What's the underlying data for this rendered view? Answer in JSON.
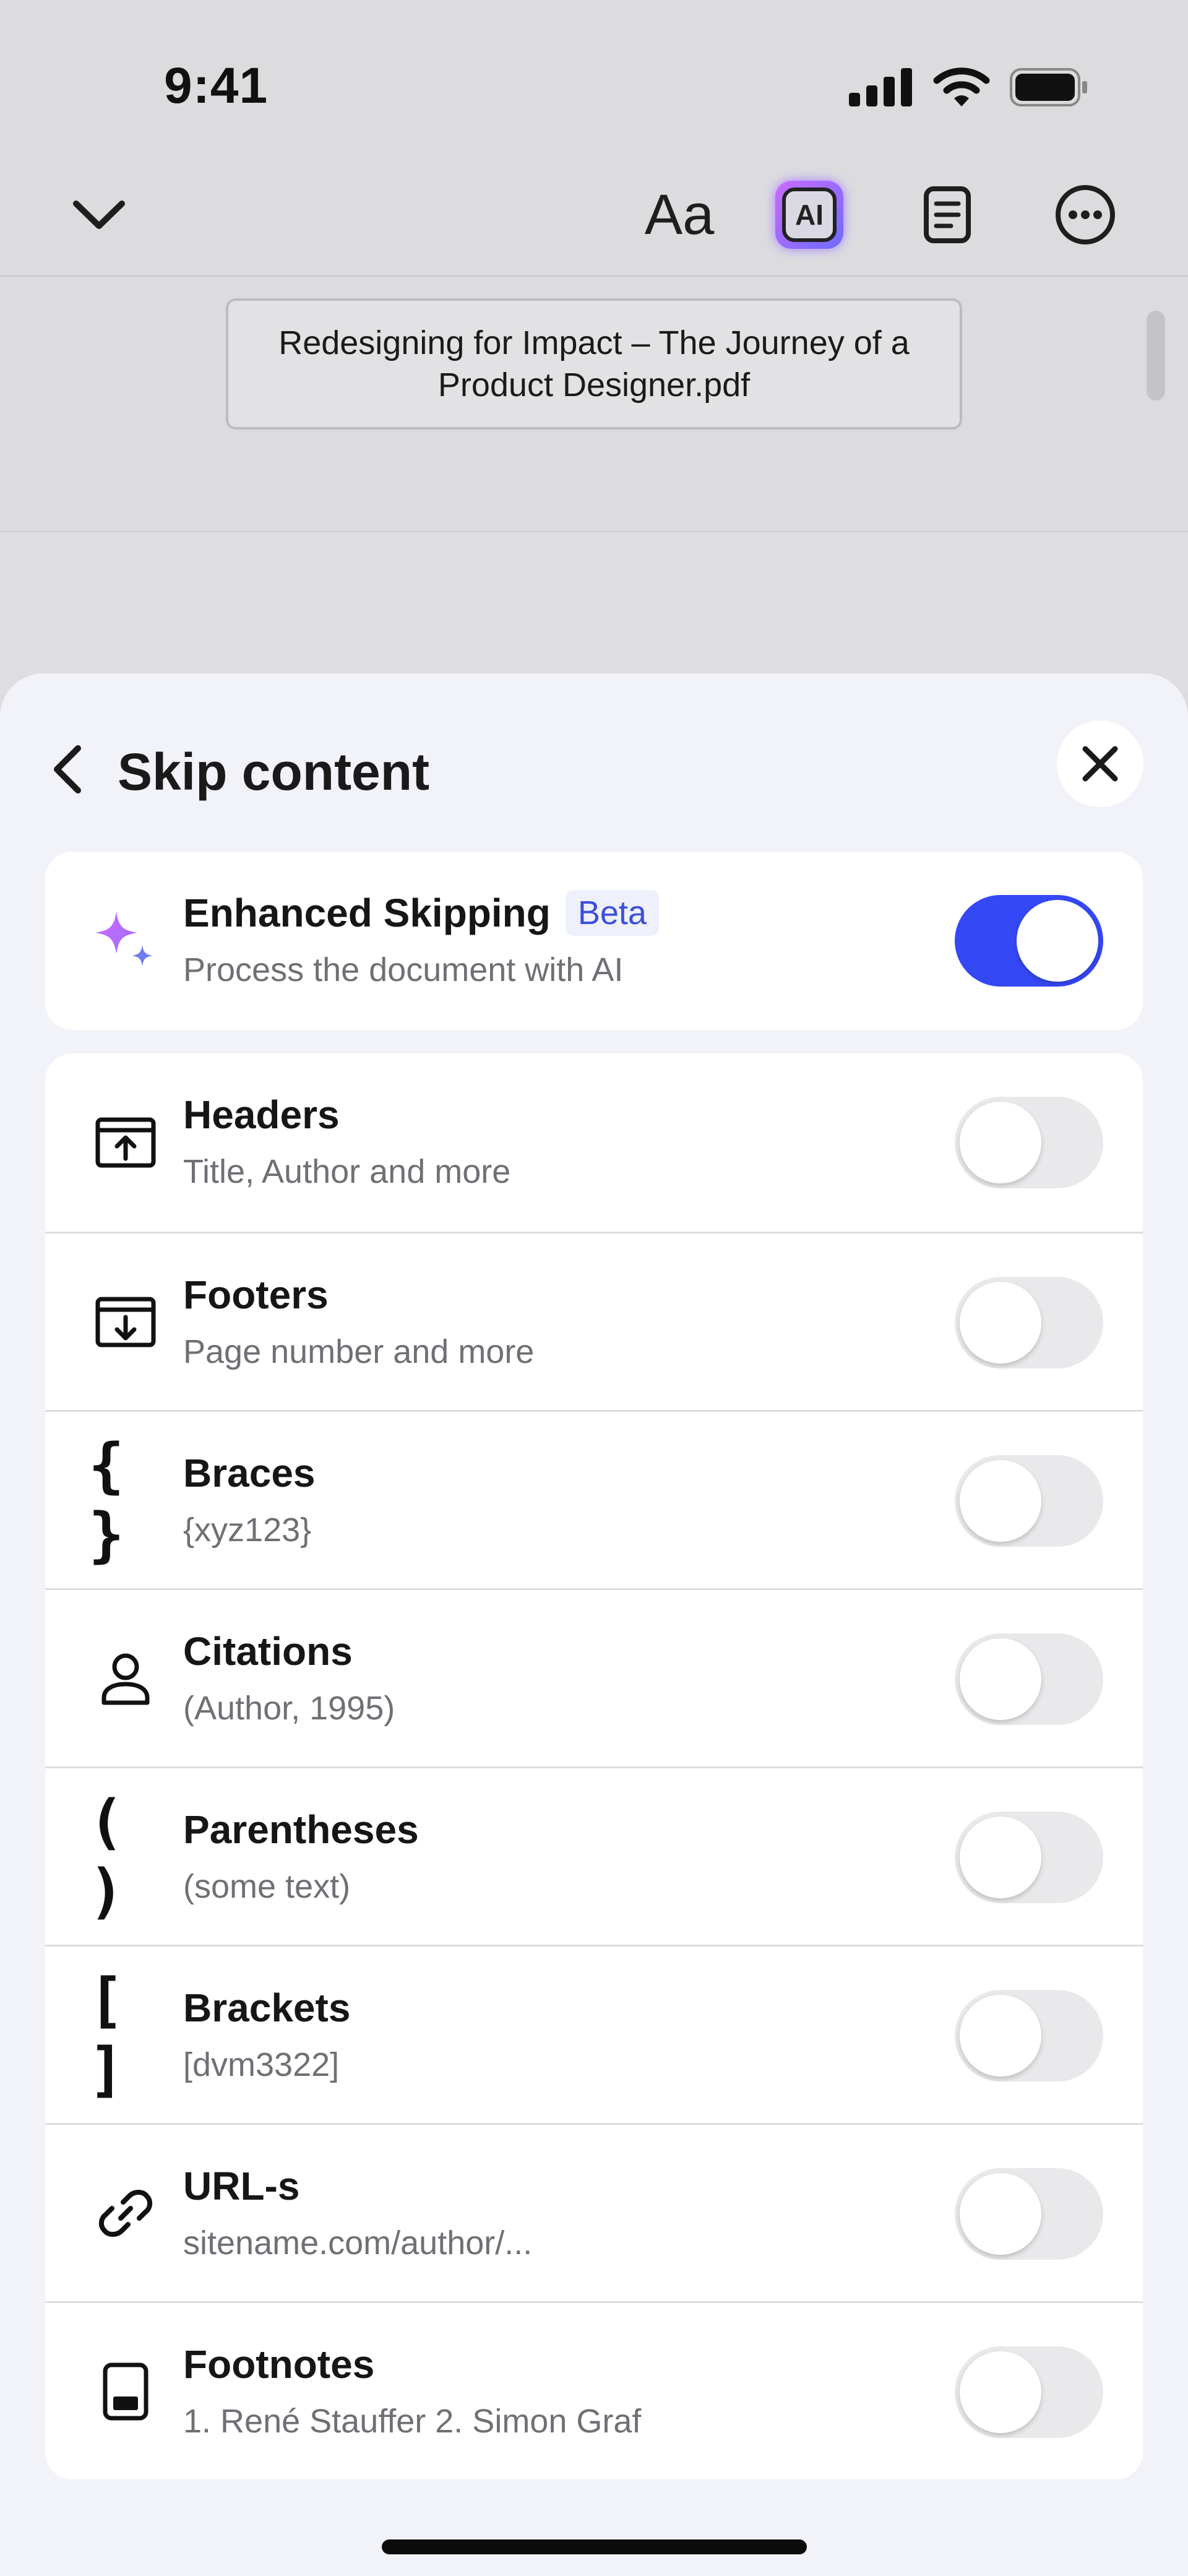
{
  "status_bar": {
    "time": "9:41"
  },
  "toolbar": {
    "font_label": "Aa",
    "ai_label": "AI"
  },
  "document": {
    "filename": "Redesigning for Impact – The Journey of a Product Designer.pdf"
  },
  "sheet": {
    "title": "Skip content",
    "ai_feature": {
      "title": "Enhanced Skipping",
      "badge": "Beta",
      "subtitle": "Process the document with AI",
      "enabled": true,
      "icon": "sparkle-icon"
    },
    "options": [
      {
        "key": "headers",
        "title": "Headers",
        "subtitle": "Title, Author and more",
        "enabled": false,
        "icon": "header-icon"
      },
      {
        "key": "footers",
        "title": "Footers",
        "subtitle": "Page number and more",
        "enabled": false,
        "icon": "footer-icon"
      },
      {
        "key": "braces",
        "title": "Braces",
        "subtitle": "{xyz123}",
        "enabled": false,
        "icon": "braces-icon",
        "glyph": "{ }"
      },
      {
        "key": "citations",
        "title": "Citations",
        "subtitle": "(Author, 1995)",
        "enabled": false,
        "icon": "person-icon"
      },
      {
        "key": "parentheses",
        "title": "Parentheses",
        "subtitle": "(some text)",
        "enabled": false,
        "icon": "parentheses-icon",
        "glyph": "( )"
      },
      {
        "key": "brackets",
        "title": "Brackets",
        "subtitle": "[dvm3322]",
        "enabled": false,
        "icon": "brackets-icon",
        "glyph": "[ ]"
      },
      {
        "key": "urls",
        "title": "URL-s",
        "subtitle": "sitename.com/author/...",
        "enabled": false,
        "icon": "link-icon"
      },
      {
        "key": "footnotes",
        "title": "Footnotes",
        "subtitle": "1. René Stauffer 2. Simon Graf",
        "enabled": false,
        "icon": "footnote-icon"
      }
    ]
  },
  "colors": {
    "accent": "#3548f5",
    "beta_text": "#3d4fd9",
    "sheet_bg": "#f2f2f9",
    "dim_bg": "#dcdcdf"
  }
}
